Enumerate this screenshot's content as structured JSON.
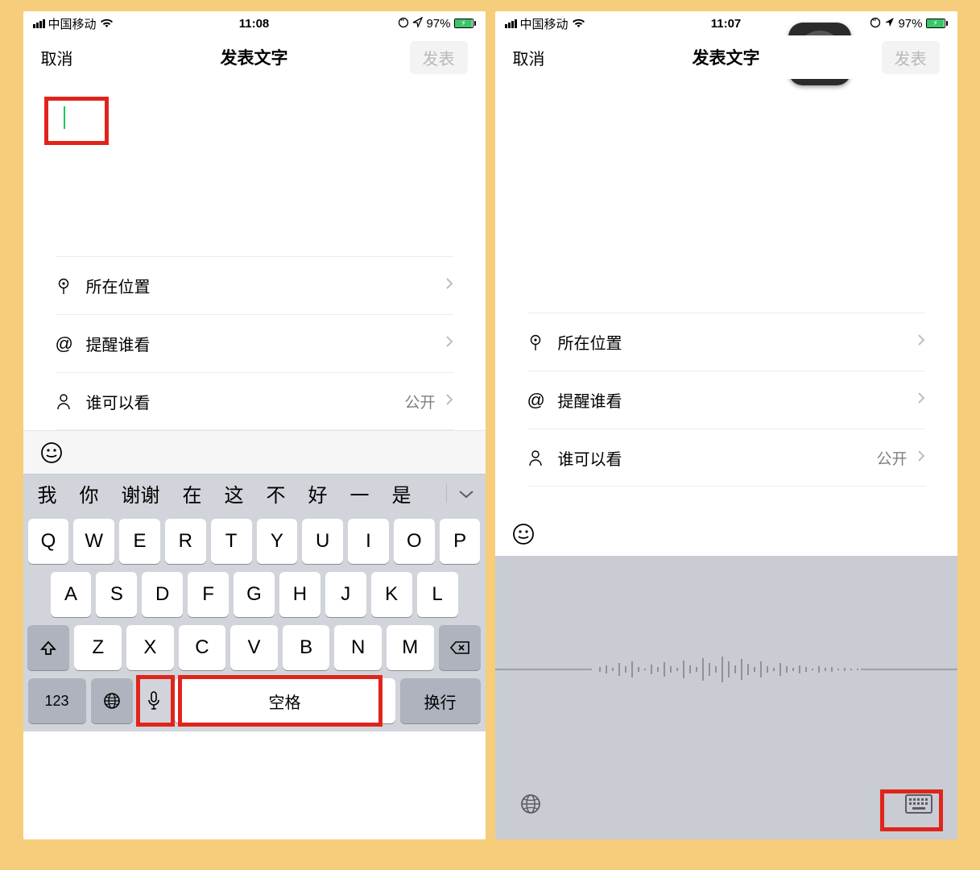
{
  "left": {
    "status": {
      "carrier": "中国移动",
      "time": "11:08",
      "battery_pct": "97%"
    },
    "nav": {
      "cancel": "取消",
      "title": "发表文字",
      "publish": "发表"
    },
    "options": {
      "location_label": "所在位置",
      "mention_label": "提醒谁看",
      "visibility_label": "谁可以看",
      "visibility_value": "公开"
    },
    "candidates": [
      "我",
      "你",
      "谢谢",
      "在",
      "这",
      "不",
      "好",
      "一",
      "是"
    ],
    "keys": {
      "row1": [
        "Q",
        "W",
        "E",
        "R",
        "T",
        "Y",
        "U",
        "I",
        "O",
        "P"
      ],
      "row2": [
        "A",
        "S",
        "D",
        "F",
        "G",
        "H",
        "J",
        "K",
        "L"
      ],
      "row3": [
        "Z",
        "X",
        "C",
        "V",
        "B",
        "N",
        "M"
      ],
      "num": "123",
      "space": "空格",
      "ret": "换行"
    }
  },
  "right": {
    "status": {
      "carrier": "中国移动",
      "time": "11:07",
      "battery_pct": "97%"
    },
    "nav": {
      "cancel": "取消",
      "title": "发表文字",
      "publish": "发表"
    },
    "options": {
      "location_label": "所在位置",
      "mention_label": "提醒谁看",
      "visibility_label": "谁可以看",
      "visibility_value": "公开"
    }
  }
}
